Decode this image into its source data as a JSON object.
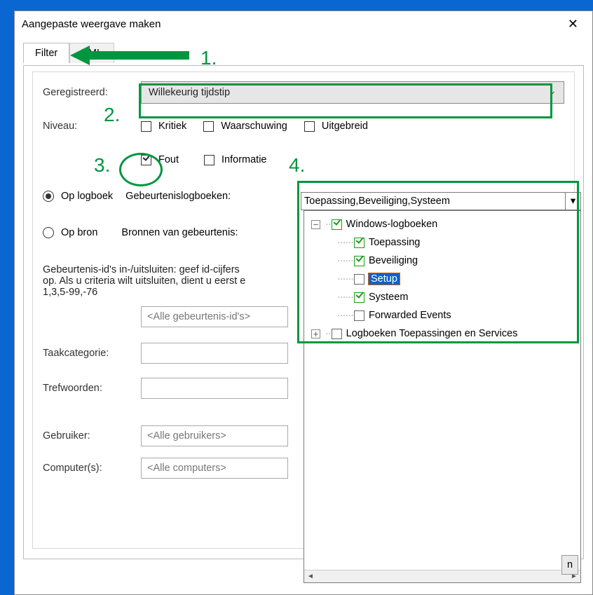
{
  "title": "Aangepaste weergave maken",
  "tabs": {
    "filter": "Filter",
    "xml": "XML"
  },
  "labels": {
    "registered": "Geregistreerd:",
    "level": "Niveau:",
    "bylog": "Op logboek",
    "bysource": "Op bron",
    "eventlogs": "Gebeurtenislogboeken:",
    "sources": "Bronnen van gebeurtenis:",
    "idshelp": "Gebeurtenis-id's in-/uitsluiten: geef id-cijfers",
    "idshelp2": "op. Als u criteria wilt uitsluiten, dient u eerst e",
    "idshelp3": "1,3,5-99,-76",
    "taskcat": "Taakcategorie:",
    "keywords": "Trefwoorden:",
    "user": "Gebruiker:",
    "computers": "Computer(s):"
  },
  "registered_value": "Willekeurig tijdstip",
  "levels": {
    "critical": "Kritiek",
    "warning": "Waarschuwing",
    "verbose": "Uitgebreid",
    "error": "Fout",
    "info": "Informatie"
  },
  "placeholders": {
    "ids": "<Alle gebeurtenis-id's>",
    "users": "<Alle gebruikers>",
    "computers": "<Alle computers>"
  },
  "eventlogs_value": "Toepassing,Beveiliging,Systeem",
  "tree": {
    "root": "Windows-logboeken",
    "app": "Toepassing",
    "sec": "Beveiliging",
    "setup": "Setup",
    "system": "Systeem",
    "fwd": "Forwarded Events",
    "appsvc": "Logboeken Toepassingen en Services"
  },
  "annotations": {
    "n1": "1.",
    "n2": "2.",
    "n3": "3.",
    "n4": "4."
  },
  "footer_btn": "n"
}
